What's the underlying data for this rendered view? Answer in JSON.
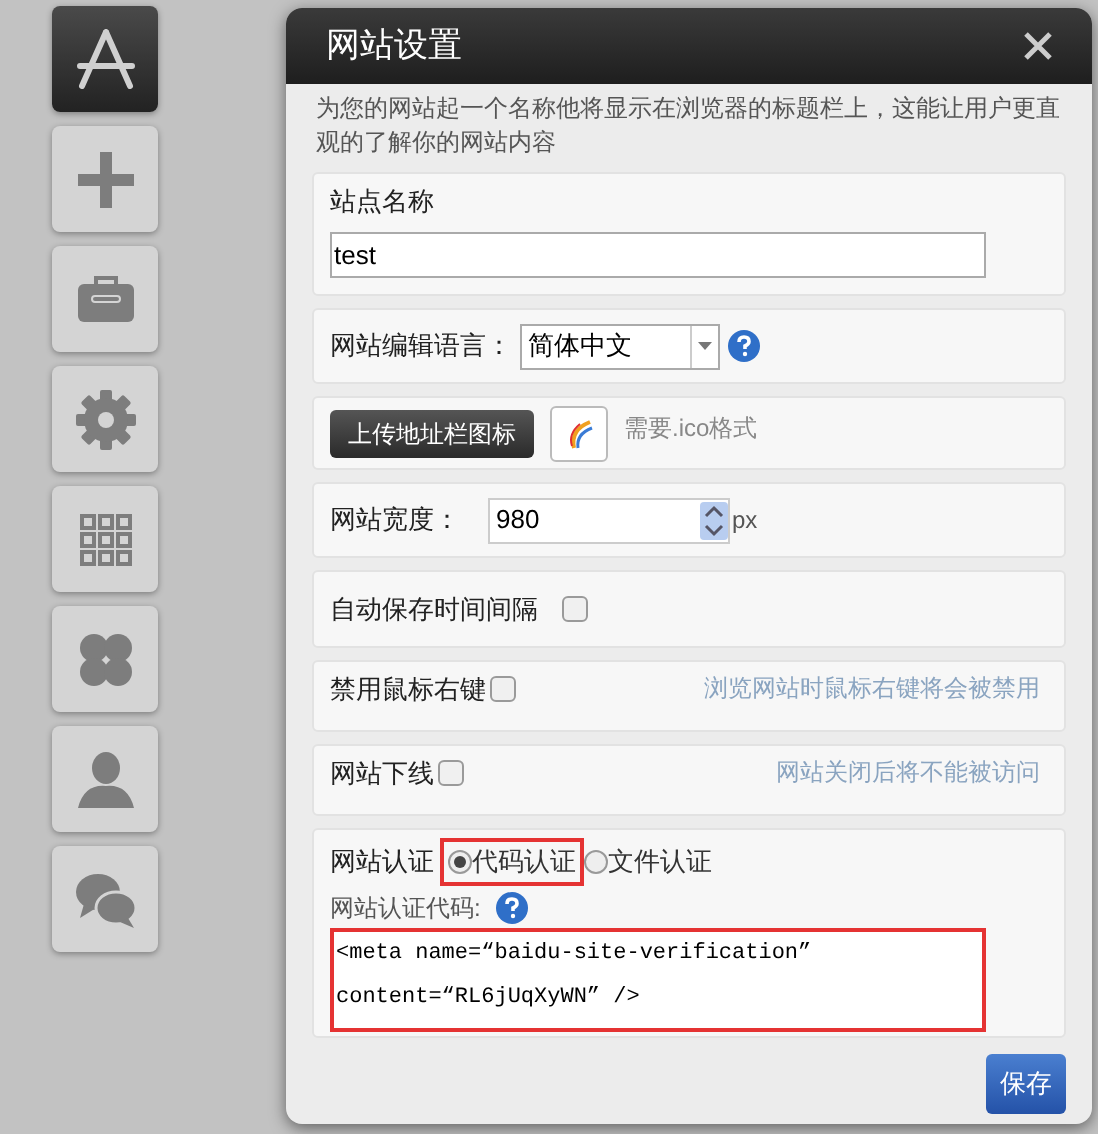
{
  "sidebar": {
    "items": [
      {
        "kind": "app-store",
        "selected": true
      },
      {
        "kind": "plus",
        "selected": false
      },
      {
        "kind": "toolbox",
        "selected": false
      },
      {
        "kind": "gear",
        "selected": false
      },
      {
        "kind": "grid",
        "selected": false
      },
      {
        "kind": "clover",
        "selected": false
      },
      {
        "kind": "user",
        "selected": false
      },
      {
        "kind": "chat",
        "selected": false
      }
    ]
  },
  "dialog": {
    "title": "网站设置",
    "description": "为您的网站起一个名称他将显示在浏览器的标题栏上，这能让用户更直观的了解你的网站内容",
    "site_name": {
      "label": "站点名称",
      "value": "test"
    },
    "language": {
      "label": "网站编辑语言：",
      "value": "简体中文"
    },
    "favicon": {
      "button": "上传地址栏图标",
      "hint": "需要.ico格式"
    },
    "width": {
      "label": "网站宽度：",
      "value": "980",
      "unit": "px"
    },
    "autosave": {
      "label": "自动保存时间间隔",
      "checked": false
    },
    "disable_right_click": {
      "label": "禁用鼠标右键",
      "checked": false,
      "note": "浏览网站时鼠标右键将会被禁用"
    },
    "offline": {
      "label": "网站下线",
      "checked": false,
      "note": "网站关闭后将不能被访问"
    },
    "verification": {
      "label": "网站认证",
      "options": [
        {
          "label": "代码认证",
          "selected": true,
          "highlighted": true
        },
        {
          "label": "文件认证",
          "selected": false,
          "highlighted": false
        }
      ],
      "code_label": "网站认证代码:",
      "code": "<meta name=“baidu-site-verification”\ncontent=“RL6jUqXyWN” />",
      "code_highlighted": true
    },
    "save": "保存"
  }
}
